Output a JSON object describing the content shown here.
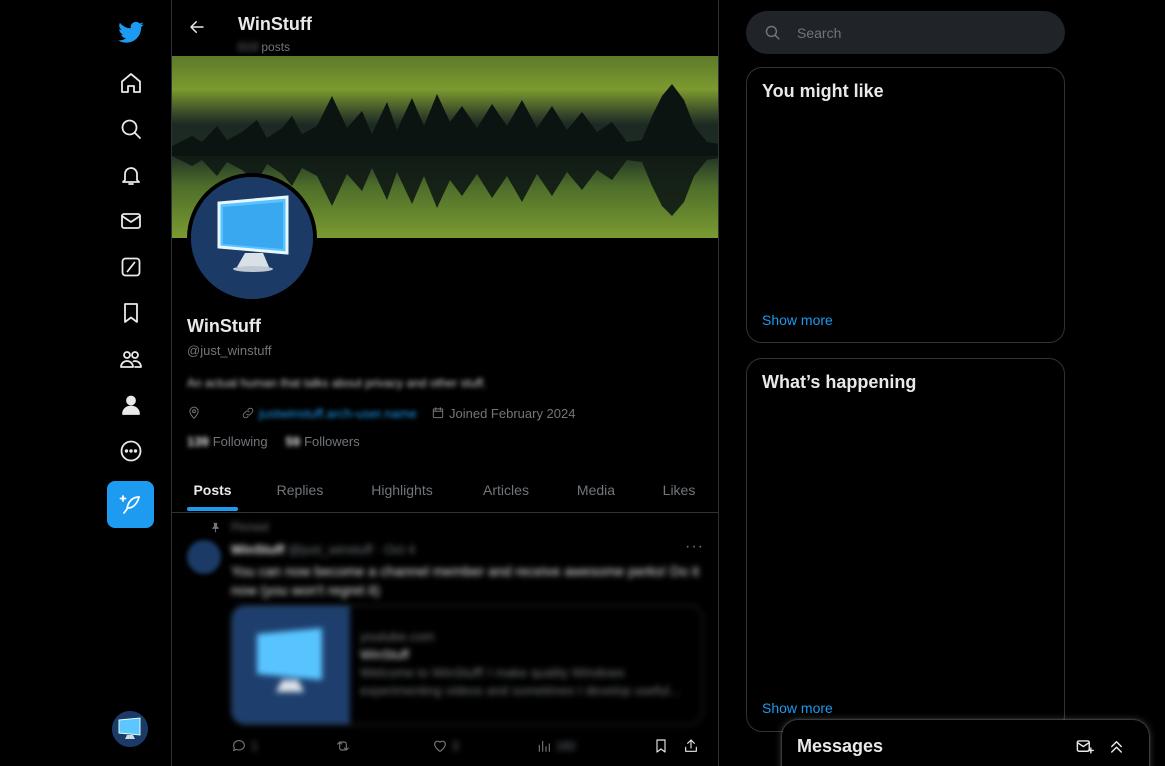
{
  "colors": {
    "accent": "#1d9bf0",
    "background": "#000000",
    "border": "#2f3336",
    "muted": "#71767b"
  },
  "nav": {
    "items": [
      {
        "icon": "twitter-bird-icon",
        "label": "Home logo"
      },
      {
        "icon": "home-icon"
      },
      {
        "icon": "search-icon"
      },
      {
        "icon": "bell-icon"
      },
      {
        "icon": "envelope-icon"
      },
      {
        "icon": "grok-slash-icon"
      },
      {
        "icon": "bookmark-icon"
      },
      {
        "icon": "communities-icon"
      },
      {
        "icon": "profile-icon"
      },
      {
        "icon": "more-circle-icon"
      }
    ],
    "post_icon": "feather-plus-icon"
  },
  "header": {
    "title": "WinStuff",
    "post_count": "619",
    "posts_label": "posts"
  },
  "profile": {
    "name": "WinStuff",
    "handle": "@just_winstuff",
    "bio": "An actual human that talks about privacy and other stuff.",
    "link": "justwinstuff.arch-user.name",
    "joined": "Joined February 2024",
    "following_count": "139",
    "following_label": "Following",
    "followers_count": "59",
    "followers_label": "Followers"
  },
  "tabs": [
    "Posts",
    "Replies",
    "Highlights",
    "Articles",
    "Media",
    "Likes"
  ],
  "pinned_tweet": {
    "pinned_label": "Pinned",
    "author": "WinStuff",
    "handle": "@just_winstuff",
    "date": "Oct 4",
    "text": "You can now become a channel member and receive awesome perks! Do it now (you won't regret it)",
    "card": {
      "domain": "youtube.com",
      "title": "WinStuff",
      "description": "Welcome to WinStuff! I make quality Windows experimenting videos and sometimes I develop useful..."
    },
    "replies": "1",
    "reposts": "",
    "likes": "3",
    "views": "182"
  },
  "search": {
    "placeholder": "Search"
  },
  "right": {
    "you_might_like": {
      "title": "You might like",
      "more": "Show more"
    },
    "whats_happening": {
      "title": "What’s happening",
      "more": "Show more"
    }
  },
  "messages": {
    "title": "Messages"
  }
}
